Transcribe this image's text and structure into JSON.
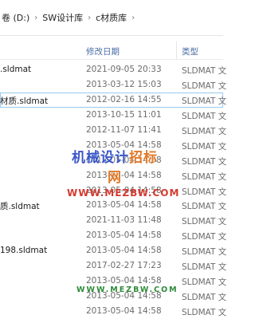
{
  "breadcrumb": {
    "items": [
      "卷 (D:)",
      "SW设计库",
      "c材质库"
    ]
  },
  "columns": {
    "date": "修改日期",
    "type": "类型"
  },
  "rows": [
    {
      "name": ".sldmat",
      "date": "2021-09-05 20:33",
      "type": "SLDMAT 文"
    },
    {
      "name": "",
      "date": "2013-03-12 15:03",
      "type": "SLDMAT 文"
    },
    {
      "name": "材质.sldmat",
      "date": "2012-02-16 14:55",
      "type": "SLDMAT 文",
      "selected": true
    },
    {
      "name": "",
      "date": "2013-10-15 11:01",
      "type": "SLDMAT 文"
    },
    {
      "name": "",
      "date": "2012-11-07 11:41",
      "type": "SLDMAT 文"
    },
    {
      "name": "",
      "date": "2013-05-04 14:58",
      "type": "SLDMAT 文"
    },
    {
      "name": "",
      "date": "2013-05-04 14:58",
      "type": "SLDMAT 文"
    },
    {
      "name": "",
      "date": "2013-05-04 14:58",
      "type": "SLDMAT 文"
    },
    {
      "name": "",
      "date": "2013-05-04 14:58",
      "type": "SLDMAT 文"
    },
    {
      "name": "质.sldmat",
      "date": "2013-05-04 14:58",
      "type": "SLDMAT 文"
    },
    {
      "name": "",
      "date": "2021-11-03 11:48",
      "type": "SLDMAT 文"
    },
    {
      "name": "",
      "date": "2013-05-04 14:58",
      "type": "SLDMAT 文"
    },
    {
      "name": "198.sldmat",
      "date": "2013-05-04 14:58",
      "type": "SLDMAT 文"
    },
    {
      "name": "",
      "date": "2017-02-27 17:23",
      "type": "SLDMAT 文"
    },
    {
      "name": "",
      "date": "2013-05-04 14:58",
      "type": "SLDMAT 文"
    },
    {
      "name": "",
      "date": "2013-05-04 14:58",
      "type": "SLDMAT 文"
    },
    {
      "name": "",
      "date": "2013-05-04 14:58",
      "type": "SLDMAT 文"
    }
  ],
  "watermark": {
    "text_a": "机械设计",
    "text_b": "招标网",
    "url": "WWW.MEZBW.COM",
    "url2": "WWW.MEZBW.COM"
  }
}
